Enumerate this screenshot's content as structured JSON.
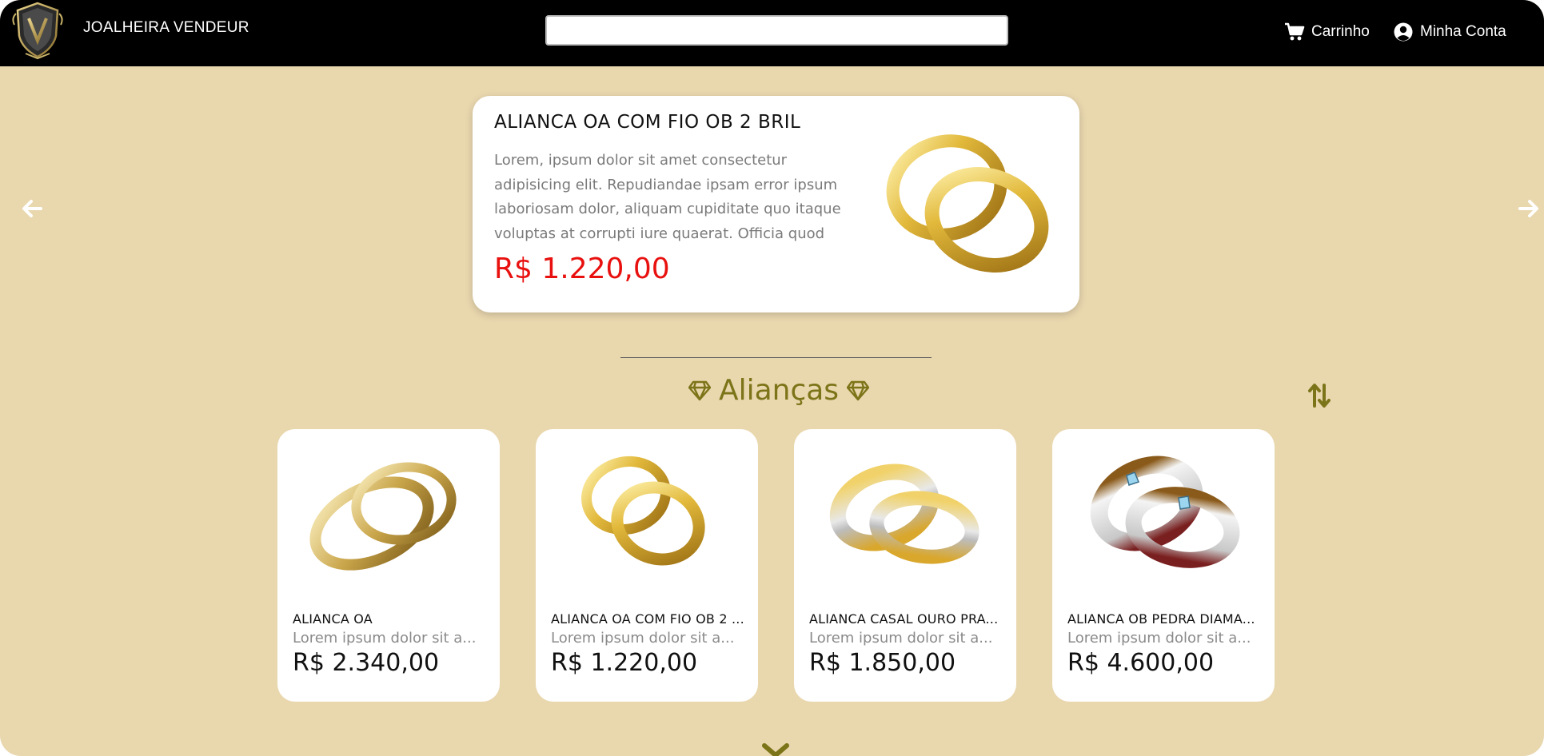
{
  "header": {
    "brand": "JOALHEIRA VENDEUR",
    "search_placeholder": "",
    "search_value": "",
    "cart_label": "Carrinho",
    "account_label": "Minha Conta"
  },
  "featured": {
    "title": "ALIANCA OA COM FIO OB 2 BRIL",
    "description": "Lorem, ipsum dolor sit amet consectetur adipisicing elit. Repudiandae ipsam error ipsum laboriosam dolor, aliquam cupiditate quo itaque voluptas at corrupti iure quaerat. Officia quod",
    "price": "R$ 1.220,00"
  },
  "section": {
    "title": "Alianças"
  },
  "products": [
    {
      "name": "ALIANCA OA",
      "description": "Lorem ipsum dolor sit a...",
      "price": "R$ 2.340,00"
    },
    {
      "name": "ALIANCA OA COM FIO OB 2 ...",
      "description": "Lorem ipsum dolor sit a...",
      "price": "R$ 1.220,00"
    },
    {
      "name": "ALIANCA CASAL OURO PRA...",
      "description": "Lorem ipsum dolor sit a...",
      "price": "R$ 1.850,00"
    },
    {
      "name": "ALIANCA OB PEDRA DIAMA...",
      "description": "Lorem ipsum dolor sit a...",
      "price": "R$ 4.600,00"
    }
  ],
  "colors": {
    "background": "#e9d7ae",
    "header": "#000000",
    "accent_olive": "#7c7418",
    "price_red": "#e8110f"
  },
  "icons": [
    "logo-crest-icon",
    "cart-icon",
    "user-circle-icon",
    "arrow-left-icon",
    "arrow-right-icon",
    "diamond-icon",
    "sort-icon",
    "chevron-down-icon"
  ]
}
